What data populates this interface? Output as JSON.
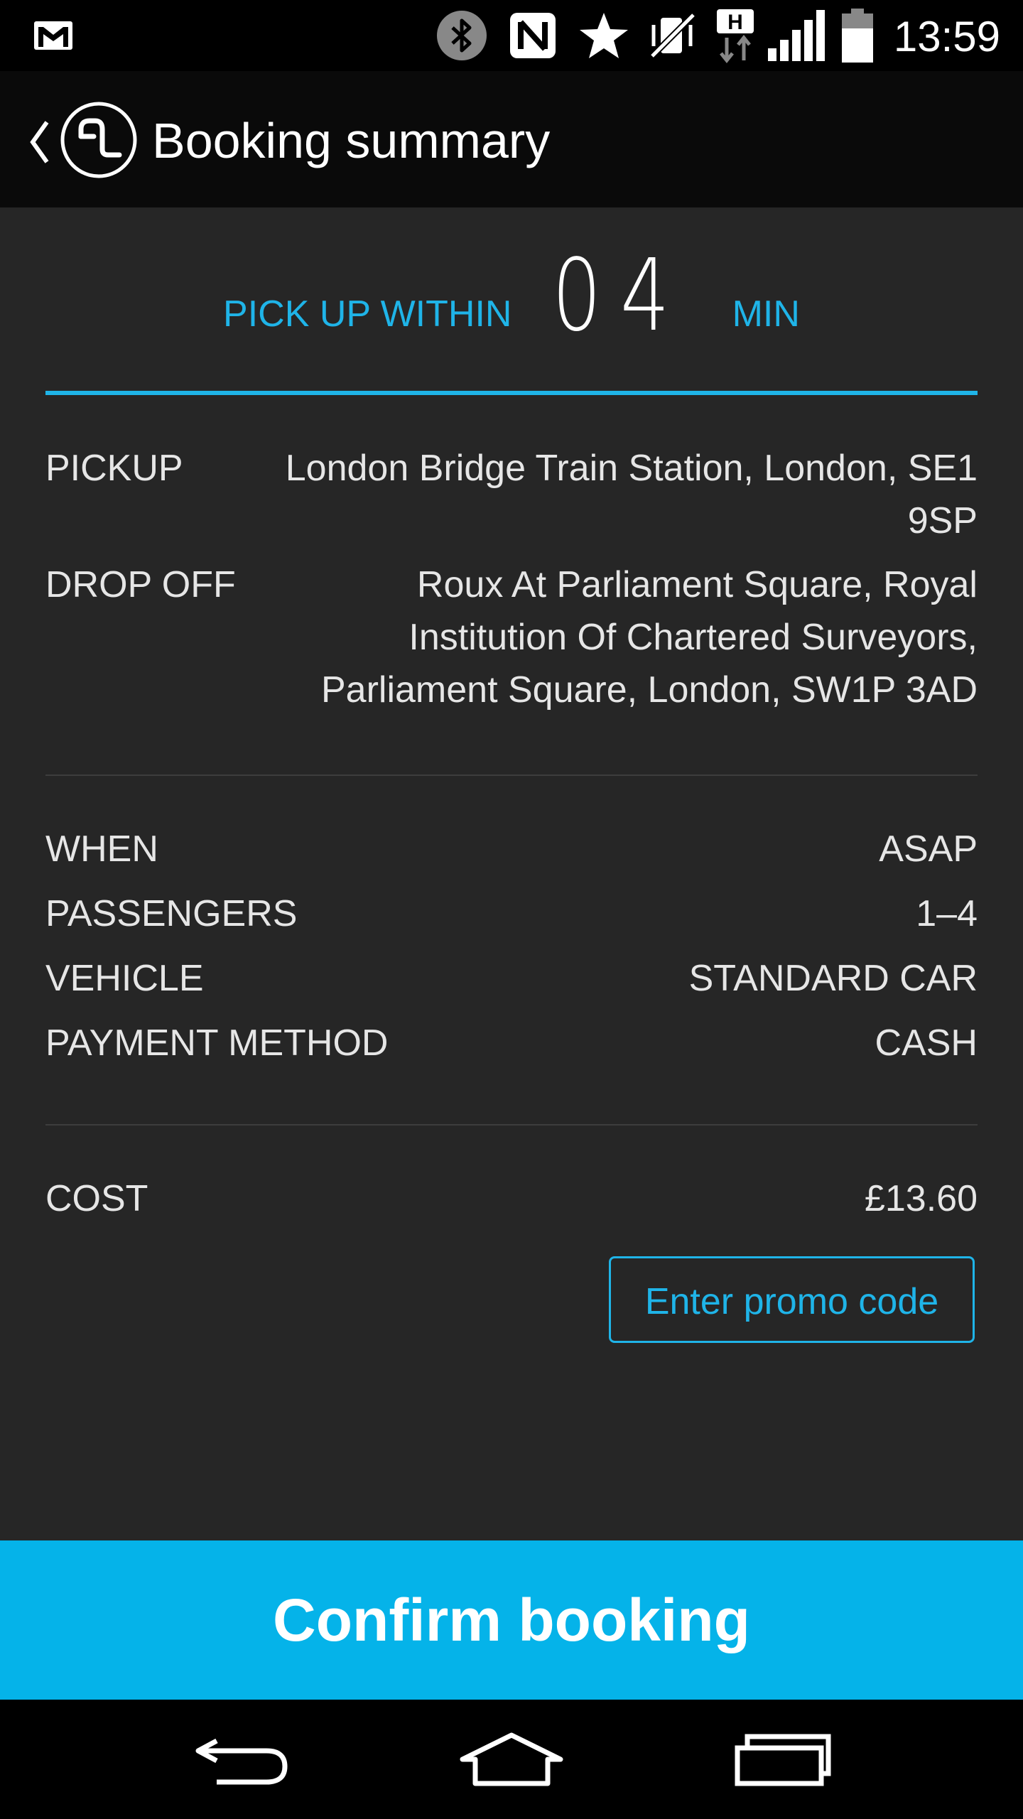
{
  "status_bar": {
    "time": "13:59",
    "icons": [
      "gmail-icon",
      "bluetooth-icon",
      "nfc-icon",
      "star-icon",
      "vibrate-off-icon",
      "hspa-data-icon",
      "signal-icon",
      "battery-icon"
    ]
  },
  "action_bar": {
    "title": "Booking summary",
    "icons": [
      "back-chevron-icon",
      "app-logo-icon"
    ]
  },
  "eta": {
    "prefix": "PICK UP WITHIN",
    "minutes": "04",
    "unit": "MIN"
  },
  "trip": {
    "pickup_label": "PICKUP",
    "pickup_value": "London Bridge Train Station, London, SE1 9SP",
    "dropoff_label": "DROP OFF",
    "dropoff_value": "Roux At Parliament Square, Royal Institution Of Chartered Surveyors, Parliament Square, London, SW1P 3AD"
  },
  "details": {
    "when_label": "WHEN",
    "when_value": "ASAP",
    "passengers_label": "PASSENGERS",
    "passengers_value": "1–4",
    "vehicle_label": "VEHICLE",
    "vehicle_value": "STANDARD CAR",
    "payment_label": "PAYMENT METHOD",
    "payment_value": "CASH"
  },
  "cost": {
    "label": "COST",
    "value": "£13.60",
    "promo_button": "Enter promo code"
  },
  "confirm_button": "Confirm booking",
  "nav_bar": {
    "icons": [
      "nav-back-icon",
      "nav-home-icon",
      "nav-recents-icon"
    ]
  },
  "colors": {
    "accent": "#1fb4e8",
    "confirm_bg": "#05b3e9",
    "content_bg": "#262626"
  }
}
